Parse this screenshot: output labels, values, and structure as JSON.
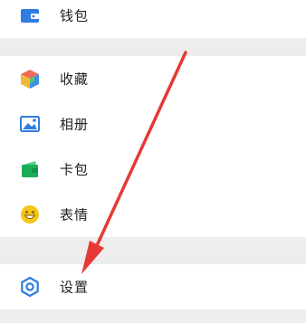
{
  "menu": {
    "wallet": {
      "label": "钱包",
      "icon": "wallet-icon"
    },
    "favorites": {
      "label": "收藏",
      "icon": "favorites-cube-icon"
    },
    "album": {
      "label": "相册",
      "icon": "album-picture-icon"
    },
    "cards": {
      "label": "卡包",
      "icon": "card-wallet-icon"
    },
    "stickers": {
      "label": "表情",
      "icon": "smiley-icon"
    },
    "settings": {
      "label": "设置",
      "icon": "gear-icon"
    }
  },
  "colors": {
    "background": "#ededed",
    "row": "#ffffff",
    "text": "#222222",
    "wallet_blue": "#2f7de1",
    "cards_green": "#1aad5a",
    "smiley_yellow": "#f5c518",
    "settings_blue": "#2f7de1",
    "annotation_arrow": "#e53935"
  }
}
